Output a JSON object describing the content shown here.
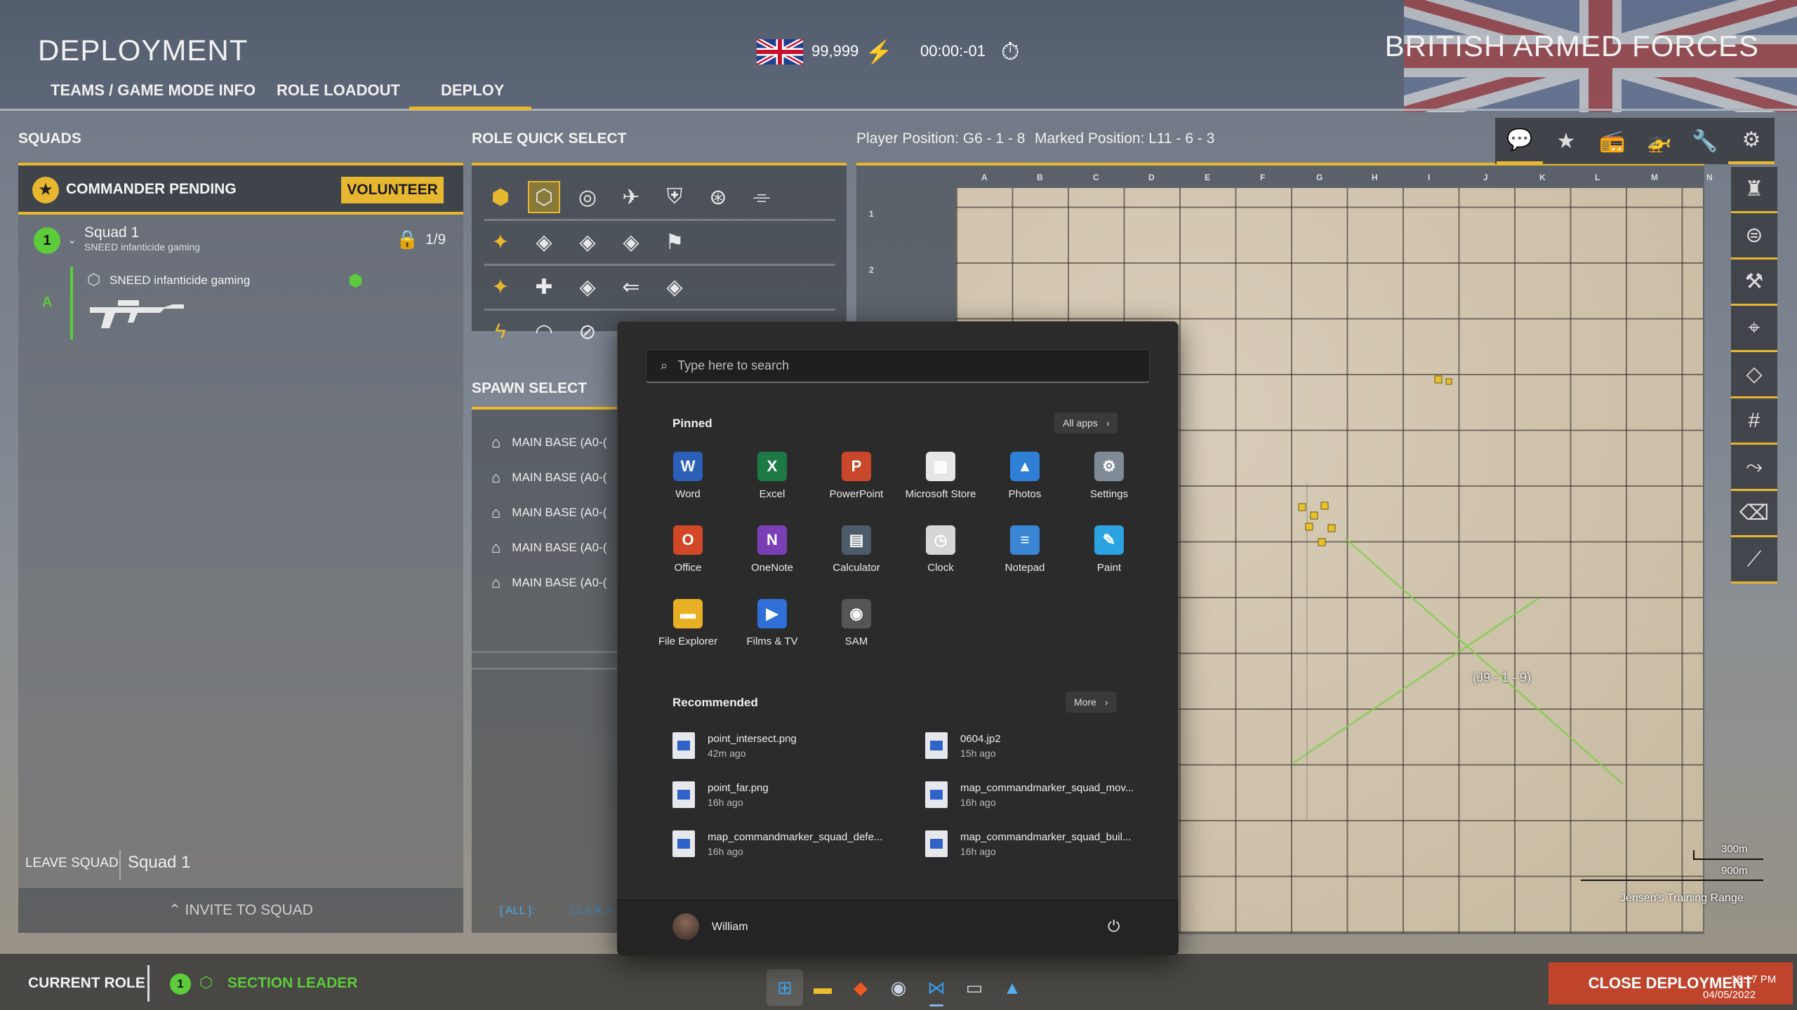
{
  "header": {
    "title": "DEPLOYMENT",
    "faction": "BRITISH ARMED FORCES",
    "tickets": "99,999",
    "timer": "00:00:-01",
    "tabs": [
      {
        "label": "TEAMS / GAME MODE INFO"
      },
      {
        "label": "ROLE LOADOUT"
      },
      {
        "label": "DEPLOY"
      }
    ]
  },
  "squads": {
    "heading": "SQUADS",
    "commander": "COMMANDER PENDING",
    "volunteer": "VOLUNTEER",
    "squad_number": "1",
    "squad_name": "Squad 1",
    "squad_leader": "SNEED infanticide gaming",
    "squad_count": "1/9",
    "member_name": "SNEED infanticide gaming",
    "fireteam": "A",
    "leave": "LEAVE SQUAD",
    "current_squad": "Squad 1",
    "invite": "INVITE TO SQUAD"
  },
  "roles": {
    "heading": "ROLE QUICK SELECT"
  },
  "spawn": {
    "heading": "SPAWN SELECT",
    "items": [
      "MAIN BASE (A0-(",
      "MAIN BASE (A0-(",
      "MAIN BASE (A0-(",
      "MAIN BASE (A0-(",
      "MAIN BASE (A0-("
    ],
    "filter_all": "[ ALL ]:",
    "filter_hint": "CLICK A"
  },
  "map": {
    "player_position": "Player Position: G6 - 1 - 8",
    "marked_position": "Marked Position: L11 - 6 - 3",
    "columns": [
      "A",
      "B",
      "C",
      "D",
      "E",
      "F",
      "G",
      "H",
      "I",
      "J",
      "K",
      "L",
      "M",
      "N"
    ],
    "rows": [
      "1",
      "2"
    ],
    "marker_label": "(J9 - 1 - 9)",
    "scale_1": "300m",
    "scale_2": "900m",
    "map_name": "Jensen's Training Range"
  },
  "footer": {
    "current_role_label": "CURRENT ROLE",
    "role_squad": "1",
    "role_name": "SECTION LEADER",
    "close": "CLOSE DEPLOYMENT",
    "clock_time": "18:17 PM",
    "clock_date": "04/05/2022"
  },
  "start_menu": {
    "search_placeholder": "Type here to search",
    "pinned_label": "Pinned",
    "all_apps": "All apps",
    "apps": [
      {
        "name": "Word",
        "color": "#2b5fb8",
        "glyph": "W"
      },
      {
        "name": "Excel",
        "color": "#1d7a45",
        "glyph": "X"
      },
      {
        "name": "PowerPoint",
        "color": "#c9472a",
        "glyph": "P"
      },
      {
        "name": "Microsoft Store",
        "color": "#e6e6e6",
        "glyph": "▦"
      },
      {
        "name": "Photos",
        "color": "#2f7fd6",
        "glyph": "▲"
      },
      {
        "name": "Settings",
        "color": "#7f8a96",
        "glyph": "⚙"
      },
      {
        "name": "Office",
        "color": "#d24726",
        "glyph": "O"
      },
      {
        "name": "OneNote",
        "color": "#7b3fb5",
        "glyph": "N"
      },
      {
        "name": "Calculator",
        "color": "#4e5b6a",
        "glyph": "▤"
      },
      {
        "name": "Clock",
        "color": "#d6d6d6",
        "glyph": "◷"
      },
      {
        "name": "Notepad",
        "color": "#3b86d4",
        "glyph": "≡"
      },
      {
        "name": "Paint",
        "color": "#2aa3e0",
        "glyph": "✎"
      },
      {
        "name": "File Explorer",
        "color": "#e8b024",
        "glyph": "▬"
      },
      {
        "name": "Films & TV",
        "color": "#2f6fd6",
        "glyph": "▶"
      },
      {
        "name": "SAM",
        "color": "#555555",
        "glyph": "◉"
      }
    ],
    "recommended_label": "Recommended",
    "more": "More",
    "recommended": [
      {
        "name": "point_intersect.png",
        "time": "42m ago"
      },
      {
        "name": "0604.jp2",
        "time": "15h ago"
      },
      {
        "name": "point_far.png",
        "time": "16h ago"
      },
      {
        "name": "map_commandmarker_squad_mov...",
        "time": "16h ago"
      },
      {
        "name": "map_commandmarker_squad_defe...",
        "time": "16h ago"
      },
      {
        "name": "map_commandmarker_squad_buil...",
        "time": "16h ago"
      }
    ],
    "user": "William"
  }
}
